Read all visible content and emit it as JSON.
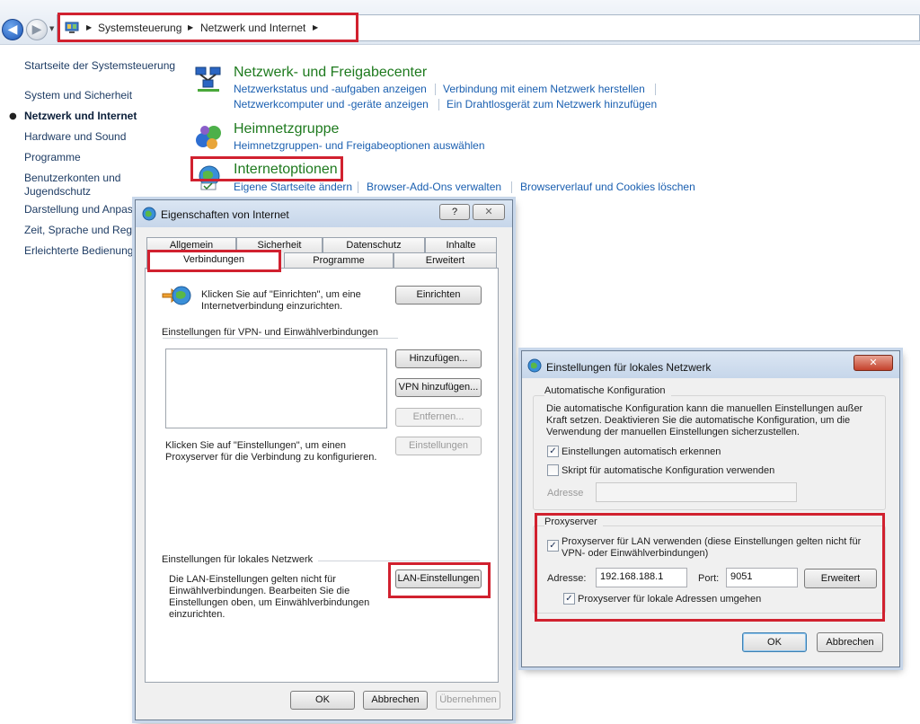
{
  "address_bar": {
    "breadcrumbs": [
      "Systemsteuerung",
      "Netzwerk und Internet"
    ]
  },
  "nav": {
    "home": "Startseite der Systemsteuerung",
    "items": [
      "System und Sicherheit",
      "Netzwerk und Internet",
      "Hardware und Sound",
      "Programme",
      "Benutzerkonten und Jugendschutz",
      "Darstellung und Anpas",
      "Zeit, Sprache und Regio",
      "Erleichterte Bedienung"
    ]
  },
  "categories": [
    {
      "title": "Netzwerk- und Freigabecenter",
      "links": [
        "Netzwerkstatus und -aufgaben anzeigen",
        "Verbindung mit einem Netzwerk herstellen",
        "Netzwerkcomputer und -geräte anzeigen",
        "Ein Drahtlosgerät zum Netzwerk hinzufügen"
      ]
    },
    {
      "title": "Heimnetzgruppe",
      "links": [
        "Heimnetzgruppen- und Freigabeoptionen auswählen"
      ]
    },
    {
      "title": "Internetoptionen",
      "links": [
        "Eigene Startseite ändern",
        "Browser-Add-Ons verwalten",
        "Browserverlauf und Cookies löschen"
      ]
    }
  ],
  "inet_dialog": {
    "title": "Eigenschaften von Internet",
    "help_glyph": "?",
    "close_glyph": "✕",
    "tabs_row1": [
      "Allgemein",
      "Sicherheit",
      "Datenschutz",
      "Inhalte"
    ],
    "tabs_row2": [
      "Verbindungen",
      "Programme",
      "Erweitert"
    ],
    "setup_text": "Klicken Sie auf \"Einrichten\", um eine Internetverbindung einzurichten.",
    "setup_button": "Einrichten",
    "vpn_group": "Einstellungen für VPN- und Einwählverbindungen",
    "add_button": "Hinzufügen...",
    "add_vpn_button": "VPN hinzufügen...",
    "remove_button": "Entfernen...",
    "settings_text": "Klicken Sie auf \"Einstellungen\", um einen Proxyserver für die Verbindung zu konfigurieren.",
    "settings_button": "Einstellungen",
    "lan_group": "Einstellungen für lokales Netzwerk",
    "lan_text": "Die LAN-Einstellungen gelten nicht für Einwählverbindungen. Bearbeiten Sie die Einstellungen oben, um Einwählverbindungen einzurichten.",
    "lan_button": "LAN-Einstellungen",
    "ok": "OK",
    "cancel": "Abbrechen",
    "apply": "Übernehmen"
  },
  "lan_dialog": {
    "title": "Einstellungen für lokales Netzwerk",
    "close_glyph": "✕",
    "auto_group": "Automatische Konfiguration",
    "auto_text": "Die automatische Konfiguration kann die manuellen Einstellungen außer Kraft setzen. Deaktivieren Sie die automatische Konfiguration, um die Verwendung der manuellen Einstellungen sicherzustellen.",
    "auto_detect": "Einstellungen automatisch erkennen",
    "auto_detect_checked": true,
    "auto_script": "Skript für automatische Konfiguration verwenden",
    "auto_script_checked": false,
    "address_label": "Adresse",
    "proxy_group": "Proxyserver",
    "use_proxy": "Proxyserver für LAN verwenden (diese Einstellungen gelten nicht für VPN- oder Einwählverbindungen)",
    "use_proxy_checked": true,
    "proxy_address_label": "Adresse:",
    "proxy_address": "192.168.188.1",
    "port_label": "Port:",
    "port": "9051",
    "advanced_button": "Erweitert",
    "bypass_local": "Proxyserver für lokale Adressen umgehen",
    "bypass_local_checked": true,
    "ok": "OK",
    "cancel": "Abbrechen"
  },
  "check_glyph": "✓"
}
